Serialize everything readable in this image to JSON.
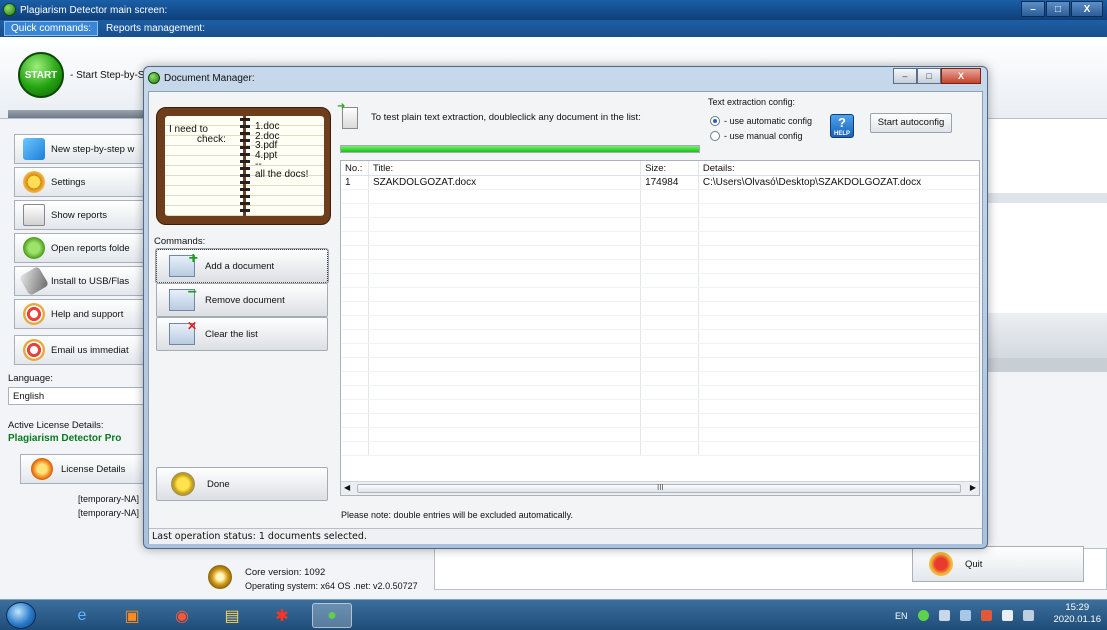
{
  "main_window": {
    "title": "Plagiarism Detector main screen:",
    "menu": [
      "Quick commands:",
      "Reports management:"
    ],
    "start_label": "- Start Step-by-S",
    "start_ball_text": "START"
  },
  "sidebar": {
    "items": [
      {
        "label": "New step-by-step w",
        "icon": "new-document-icon"
      },
      {
        "label": "Settings",
        "icon": "settings-gear-icon"
      },
      {
        "label": "Show reports",
        "icon": "reports-icon"
      },
      {
        "label": "Open reports folde",
        "icon": "folder-gear-icon"
      },
      {
        "label": "Install to USB/Flas",
        "icon": "usb-icon"
      },
      {
        "label": "Help and support",
        "icon": "lifebuoy-icon"
      },
      {
        "label": "Email us immediat",
        "icon": "lifebuoy-icon"
      }
    ],
    "language_label": "Language:",
    "language_value": "English",
    "license_label": "Active License Details:",
    "license_product": "Plagiarism Detector Pro",
    "license_button": "License Details",
    "temporary_1": "[temporary-NA]",
    "temporary_2": "[temporary-NA]"
  },
  "footer": {
    "core_version": "Core version: 1092",
    "os_info": "Operating system: x64 OS .net: v2.0.50727",
    "quit_label": "Quit"
  },
  "dialog": {
    "title": "Document Manager:",
    "notebook": {
      "left_line1": "I need to",
      "left_line2": "check:",
      "right_lines": [
        "1.doc",
        "2.doc",
        "3.pdf",
        "4.ppt",
        "--",
        "all the docs!"
      ]
    },
    "commands_label": "Commands:",
    "commands": [
      {
        "label": "Add a document",
        "icon": "add-document-icon"
      },
      {
        "label": "Remove document",
        "icon": "remove-document-icon"
      },
      {
        "label": "Clear the list",
        "icon": "clear-list-icon"
      }
    ],
    "done_label": "Done",
    "hint": "To test plain text extraction, doubleclick any document in the list:",
    "progress_fraction": 1.0,
    "config": {
      "title": "Text extraction config:",
      "options": [
        "- use automatic config",
        "- use manual config"
      ],
      "selected_index": 0,
      "help_text": "HELP",
      "autoconfig_label": "Start autoconfig"
    },
    "table": {
      "columns": [
        "No.:",
        "Title:",
        "Size:",
        "Details:"
      ],
      "rows": [
        [
          "1",
          "SZAKDOLGOZAT.docx",
          "174984",
          "C:\\Users\\Olvasó\\Desktop\\SZAKDOLGOZAT.docx"
        ]
      ],
      "empty_rows": 19
    },
    "note": "Please note: double entries will be excluded automatically.",
    "status": "Last operation status: 1 documents selected."
  },
  "taskbar": {
    "tray_language": "EN",
    "time": "15:29",
    "date": "2020.01.16"
  },
  "colors": {
    "progress": "#17c11a",
    "license_product": "#0a7a1e",
    "titlebar": "#1a5fa8"
  }
}
